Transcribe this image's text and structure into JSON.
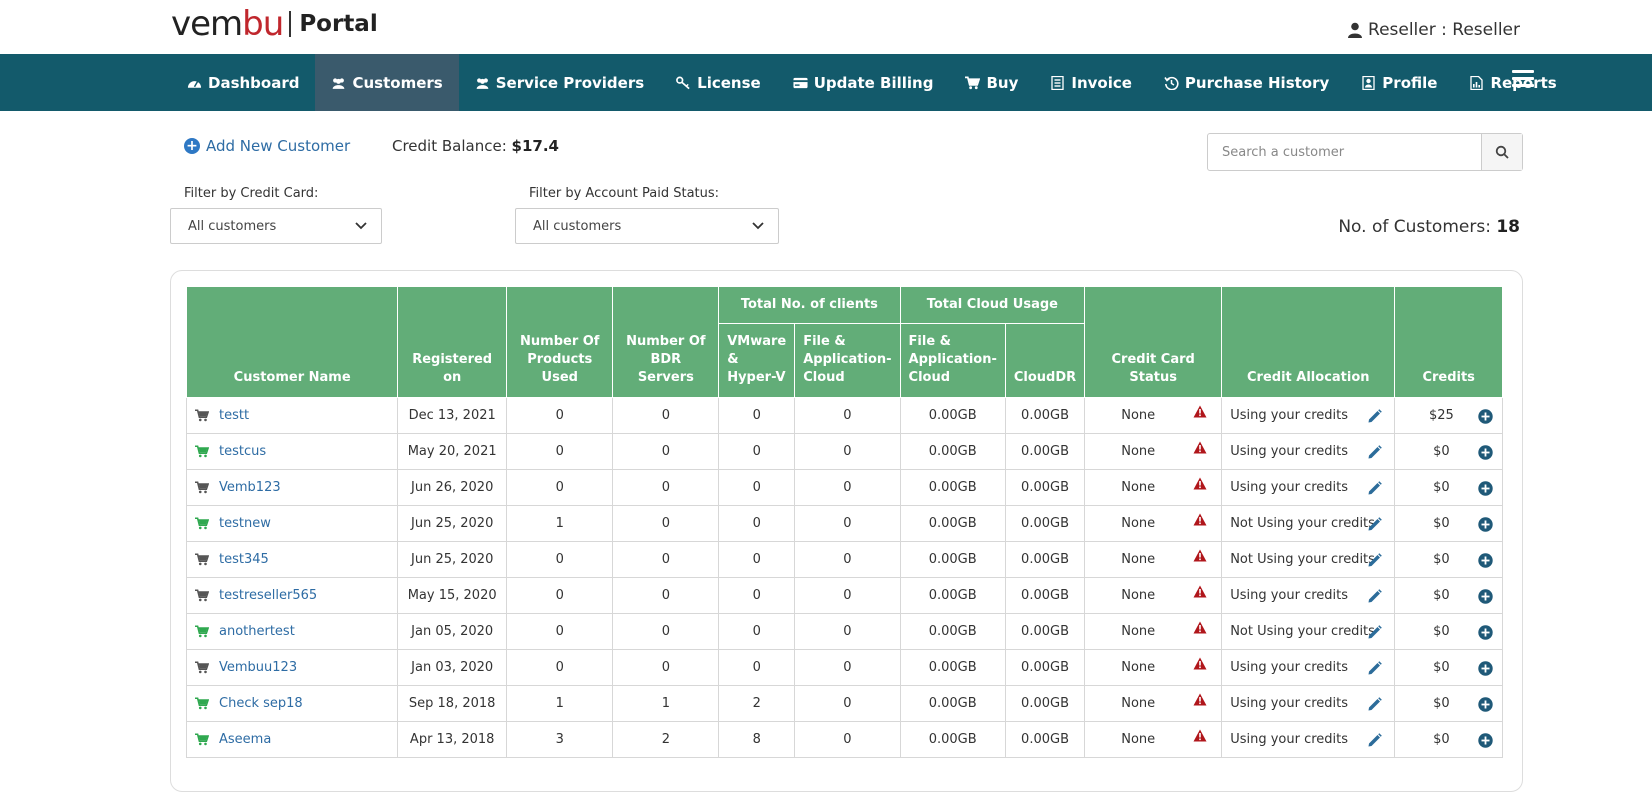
{
  "brand": {
    "logo_text_1": "vem",
    "logo_text_2": "bu",
    "portal": "Portal"
  },
  "user": {
    "label": "Reseller : Reseller"
  },
  "nav": {
    "items": [
      {
        "label": "Dashboard",
        "icon": "dashboard-icon"
      },
      {
        "label": "Customers",
        "icon": "users-icon",
        "active": true
      },
      {
        "label": "Service Providers",
        "icon": "users-icon"
      },
      {
        "label": "License",
        "icon": "key-icon"
      },
      {
        "label": "Update Billing",
        "icon": "credit-card-icon"
      },
      {
        "label": "Buy",
        "icon": "cart-icon"
      },
      {
        "label": "Invoice",
        "icon": "invoice-icon"
      },
      {
        "label": "Purchase History",
        "icon": "history-icon"
      },
      {
        "label": "Profile",
        "icon": "profile-icon"
      },
      {
        "label": "Reports",
        "icon": "reports-icon"
      }
    ]
  },
  "toolbar": {
    "add_new": "Add New Customer",
    "credit_label": "Credit Balance:",
    "credit_value": "$17.4",
    "search_placeholder": "Search a customer"
  },
  "filters": {
    "credit_card_label": "Filter by Credit Card:",
    "credit_card_value": "All customers",
    "paid_status_label": "Filter by Account Paid Status:",
    "paid_status_value": "All customers"
  },
  "count": {
    "label": "No. of Customers:",
    "value": "18"
  },
  "table": {
    "headers": {
      "customer_name": "Customer Name",
      "registered_on": "Registered on",
      "products_used": "Number Of Products Used",
      "bdr_servers": "Number Of BDR Servers",
      "total_clients": "Total No. of clients",
      "vmware": "VMware & Hyper-V",
      "file_app": "File & Application-Cloud",
      "cloud_usage": "Total Cloud Usage",
      "file_app_cloud": "File & Application-Cloud",
      "clouddr": "CloudDR",
      "cc_status": "Credit Card Status",
      "allocation": "Credit Allocation",
      "credits": "Credits"
    },
    "rows": [
      {
        "name": "testt",
        "cart": "gray",
        "registered": "Dec 13, 2021",
        "products": "0",
        "bdr": "0",
        "vmware": "0",
        "fileapp": "0",
        "cloud_fileapp": "0.00GB",
        "clouddr": "0.00GB",
        "cc": "None",
        "alloc": "Using your credits",
        "credits": "$25"
      },
      {
        "name": "testcus",
        "cart": "green",
        "registered": "May 20, 2021",
        "products": "0",
        "bdr": "0",
        "vmware": "0",
        "fileapp": "0",
        "cloud_fileapp": "0.00GB",
        "clouddr": "0.00GB",
        "cc": "None",
        "alloc": "Using your credits",
        "credits": "$0"
      },
      {
        "name": "Vemb123",
        "cart": "gray",
        "registered": "Jun 26, 2020",
        "products": "0",
        "bdr": "0",
        "vmware": "0",
        "fileapp": "0",
        "cloud_fileapp": "0.00GB",
        "clouddr": "0.00GB",
        "cc": "None",
        "alloc": "Using your credits",
        "credits": "$0"
      },
      {
        "name": "testnew",
        "cart": "green",
        "registered": "Jun 25, 2020",
        "products": "1",
        "bdr": "0",
        "vmware": "0",
        "fileapp": "0",
        "cloud_fileapp": "0.00GB",
        "clouddr": "0.00GB",
        "cc": "None",
        "alloc": "Not Using your credits",
        "credits": "$0"
      },
      {
        "name": "test345",
        "cart": "gray",
        "registered": "Jun 25, 2020",
        "products": "0",
        "bdr": "0",
        "vmware": "0",
        "fileapp": "0",
        "cloud_fileapp": "0.00GB",
        "clouddr": "0.00GB",
        "cc": "None",
        "alloc": "Not Using your credits",
        "credits": "$0"
      },
      {
        "name": "testreseller565",
        "cart": "gray",
        "registered": "May 15, 2020",
        "products": "0",
        "bdr": "0",
        "vmware": "0",
        "fileapp": "0",
        "cloud_fileapp": "0.00GB",
        "clouddr": "0.00GB",
        "cc": "None",
        "alloc": "Using your credits",
        "credits": "$0"
      },
      {
        "name": "anothertest",
        "cart": "green",
        "registered": "Jan 05, 2020",
        "products": "0",
        "bdr": "0",
        "vmware": "0",
        "fileapp": "0",
        "cloud_fileapp": "0.00GB",
        "clouddr": "0.00GB",
        "cc": "None",
        "alloc": "Not Using your credits",
        "credits": "$0"
      },
      {
        "name": "Vembuu123",
        "cart": "gray",
        "registered": "Jan 03, 2020",
        "products": "0",
        "bdr": "0",
        "vmware": "0",
        "fileapp": "0",
        "cloud_fileapp": "0.00GB",
        "clouddr": "0.00GB",
        "cc": "None",
        "alloc": "Using your credits",
        "credits": "$0"
      },
      {
        "name": "Check sep18",
        "cart": "green",
        "registered": "Sep 18, 2018",
        "products": "1",
        "bdr": "1",
        "vmware": "2",
        "fileapp": "0",
        "cloud_fileapp": "0.00GB",
        "clouddr": "0.00GB",
        "cc": "None",
        "alloc": "Using your credits",
        "credits": "$0"
      },
      {
        "name": "Aseema",
        "cart": "green",
        "registered": "Apr 13, 2018",
        "products": "3",
        "bdr": "2",
        "vmware": "8",
        "fileapp": "0",
        "cloud_fileapp": "0.00GB",
        "clouddr": "0.00GB",
        "cc": "None",
        "alloc": "Using your credits",
        "credits": "$0"
      }
    ]
  },
  "colors": {
    "nav_bg": "#135a6b",
    "nav_active": "#3a5a6c",
    "header_green": "#62ad78",
    "link_blue": "#2e6ca4",
    "cart_green": "#2fa84f",
    "cart_gray": "#555555",
    "warn_red": "#b0161b"
  }
}
